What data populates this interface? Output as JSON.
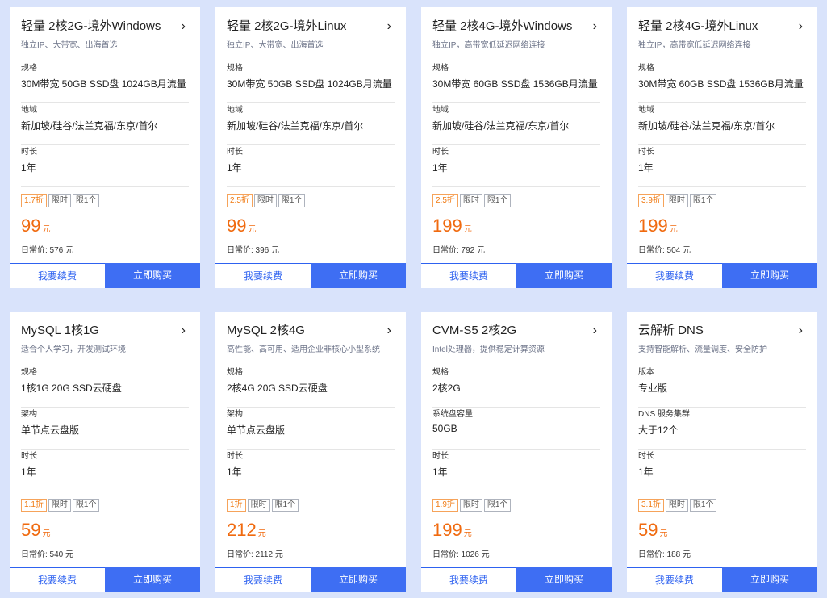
{
  "cards": [
    {
      "title": "轻量 2核2G-境外Windows",
      "subtitle": "独立IP、大带宽、出海首选",
      "specs": [
        {
          "label": "规格",
          "value": "30M带宽 50GB SSD盘 1024GB月流量"
        },
        {
          "label": "地域",
          "value": "新加坡/硅谷/法兰克福/东京/首尔"
        },
        {
          "label": "时长",
          "value": "1年"
        }
      ],
      "tags": [
        "1.7折",
        "限时",
        "限1个"
      ],
      "price": "99",
      "unit": "元",
      "original": "日常价: 576 元",
      "renew": "我要续费",
      "buy": "立即购买"
    },
    {
      "title": "轻量 2核2G-境外Linux",
      "subtitle": "独立IP、大带宽、出海首选",
      "specs": [
        {
          "label": "规格",
          "value": "30M带宽 50GB SSD盘 1024GB月流量"
        },
        {
          "label": "地域",
          "value": "新加坡/硅谷/法兰克福/东京/首尔"
        },
        {
          "label": "时长",
          "value": "1年"
        }
      ],
      "tags": [
        "2.5折",
        "限时",
        "限1个"
      ],
      "price": "99",
      "unit": "元",
      "original": "日常价: 396 元",
      "renew": "我要续费",
      "buy": "立即购买"
    },
    {
      "title": "轻量 2核4G-境外Windows",
      "subtitle": "独立IP，高带宽低延迟网络连接",
      "specs": [
        {
          "label": "规格",
          "value": "30M带宽 60GB SSD盘 1536GB月流量"
        },
        {
          "label": "地域",
          "value": "新加坡/硅谷/法兰克福/东京/首尔"
        },
        {
          "label": "时长",
          "value": "1年"
        }
      ],
      "tags": [
        "2.5折",
        "限时",
        "限1个"
      ],
      "price": "199",
      "unit": "元",
      "original": "日常价: 792 元",
      "renew": "我要续费",
      "buy": "立即购买"
    },
    {
      "title": "轻量 2核4G-境外Linux",
      "subtitle": "独立IP，高带宽低延迟网络连接",
      "specs": [
        {
          "label": "规格",
          "value": "30M带宽 60GB SSD盘 1536GB月流量"
        },
        {
          "label": "地域",
          "value": "新加坡/硅谷/法兰克福/东京/首尔"
        },
        {
          "label": "时长",
          "value": "1年"
        }
      ],
      "tags": [
        "3.9折",
        "限时",
        "限1个"
      ],
      "price": "199",
      "unit": "元",
      "original": "日常价: 504 元",
      "renew": "我要续费",
      "buy": "立即购买"
    },
    {
      "title": "MySQL 1核1G",
      "subtitle": "适合个人学习，开发测试环境",
      "specs": [
        {
          "label": "规格",
          "value": "1核1G 20G SSD云硬盘"
        },
        {
          "label": "架构",
          "value": "单节点云盘版"
        },
        {
          "label": "时长",
          "value": "1年"
        }
      ],
      "tags": [
        "1.1折",
        "限时",
        "限1个"
      ],
      "price": "59",
      "unit": "元",
      "original": "日常价: 540 元",
      "renew": "我要续费",
      "buy": "立即购买"
    },
    {
      "title": "MySQL 2核4G",
      "subtitle": "高性能、高可用、适用企业非核心小型系统",
      "specs": [
        {
          "label": "规格",
          "value": "2核4G 20G SSD云硬盘"
        },
        {
          "label": "架构",
          "value": "单节点云盘版"
        },
        {
          "label": "时长",
          "value": "1年"
        }
      ],
      "tags": [
        "1折",
        "限时",
        "限1个"
      ],
      "price": "212",
      "unit": "元",
      "original": "日常价: 2112 元",
      "renew": "我要续费",
      "buy": "立即购买"
    },
    {
      "title": "CVM-S5 2核2G",
      "subtitle": "Intel处理器，提供稳定计算资源",
      "specs": [
        {
          "label": "规格",
          "value": "2核2G"
        },
        {
          "label": "系统盘容量",
          "value": "50GB"
        },
        {
          "label": "时长",
          "value": "1年"
        }
      ],
      "tags": [
        "1.9折",
        "限时",
        "限1个"
      ],
      "price": "199",
      "unit": "元",
      "original": "日常价: 1026 元",
      "renew": "我要续费",
      "buy": "立即购买"
    },
    {
      "title": "云解析 DNS",
      "subtitle": "支持智能解析、流量调度、安全防护",
      "specs": [
        {
          "label": "版本",
          "value": "专业版"
        },
        {
          "label": "DNS 服务集群",
          "value": "大于12个"
        },
        {
          "label": "时长",
          "value": "1年"
        }
      ],
      "tags": [
        "3.1折",
        "限时",
        "限1个"
      ],
      "price": "59",
      "unit": "元",
      "original": "日常价: 188 元",
      "renew": "我要续费",
      "buy": "立即购买"
    }
  ],
  "colors": {
    "background": "#d9e3fb",
    "price": "#f06a0f",
    "buy_button": "#3e6ef3",
    "renew_text": "#2e62f0",
    "discount_tag": "#f07a12"
  },
  "icons": {
    "card_link": "chevron-right-icon"
  }
}
